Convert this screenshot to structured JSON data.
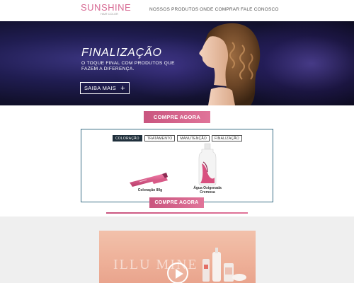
{
  "header": {
    "logo_text": "SUNSHINE",
    "logo_subtext": "HAIR COLOR",
    "nav": [
      "NOSSOS PRODUTOS",
      "ONDE COMPRAR",
      "FALE CONOSCO"
    ]
  },
  "hero": {
    "title": "FINALIZAÇÃO",
    "subtitle": "O TOQUE FINAL COM PRODUTOS QUE FAZEM A DIFERENÇA.",
    "cta_label": "SAIBA MAIS",
    "cta_icon": "plus-icon"
  },
  "compre_top_label": "COMPRE AGORA",
  "products": {
    "tabs": [
      {
        "label": "COLORAÇÃO",
        "active": true
      },
      {
        "label": "TRATAMENTO",
        "active": false
      },
      {
        "label": "MANUTENÇÃO",
        "active": false
      },
      {
        "label": "FINALIZAÇÃO",
        "active": false
      }
    ],
    "items": [
      {
        "name": "Coloração 80g"
      },
      {
        "name": "Água Oxigenada Cremosa"
      }
    ]
  },
  "compre_bottom_label": "COMPRE AGORA",
  "video": {
    "brand_text": "ILLU MINE",
    "play_icon": "play-icon"
  },
  "colors": {
    "accent": "#d96b94",
    "tab_active": "#1f2f3b",
    "box_border": "#3b6f86"
  }
}
